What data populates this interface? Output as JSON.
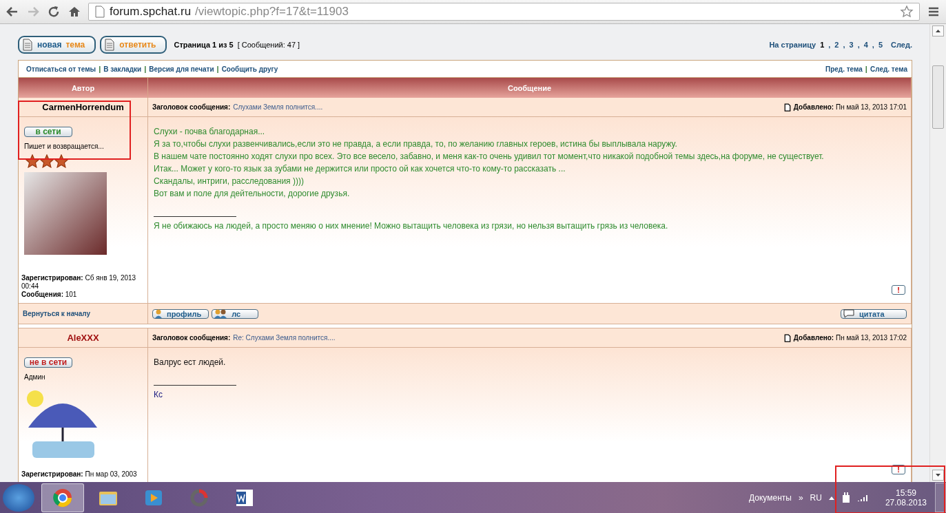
{
  "browser": {
    "url_host": "forum.spchat.ru",
    "url_path": "/viewtopic.php?f=17&t=11903"
  },
  "topic_actions": [
    {
      "label": "новая",
      "accent": "тема"
    },
    {
      "label": "ответить"
    }
  ],
  "page_info": "Страница 1 из 5",
  "post_count": "[ Сообщений: 47 ]",
  "pagination": {
    "label": "На страницу",
    "separator": ",",
    "pages": [
      {
        "label": "1",
        "selected": true
      },
      {
        "label": "2",
        "selected": false
      },
      {
        "label": "3",
        "selected": false
      },
      {
        "label": "4",
        "selected": false
      },
      {
        "label": "5",
        "selected": false
      }
    ],
    "next": "След."
  },
  "link_separator": "|",
  "topic_links": [
    "Отписаться от темы",
    "В закладки",
    "Версия для печати",
    "Сообщить другу"
  ],
  "topic_nav": [
    "Пред. тема",
    "След. тема"
  ],
  "columns": [
    "Автор",
    "Сообщение"
  ],
  "posts": [
    {
      "kind": "member",
      "author": "CarmenHorrendum",
      "status": {
        "label": "в сети",
        "online": true
      },
      "rank": "Пишет и возвращается...",
      "stars": 3,
      "registered_label": "Зарегистрирован:",
      "registered": "Сб янв 19, 2013 00:44",
      "posts_label": "Сообщения:",
      "posts": "101",
      "subject_label": "Заголовок сообщения:",
      "subject": "Слухами Земля полнится....",
      "date_label": "Добавлено:",
      "date": "Пн май 13, 2013 17:01",
      "report": "!",
      "body": [
        "Слухи - почва благодарная...",
        "Я за то,чтобы слухи развенчивались,если это не правда, а если правда, то, по желанию главных героев, истина бы выплывала наружу.",
        "В нашем чате постоянно ходят слухи про всех. Это все весело, забавно, и меня как-то очень удивил тот момент,что никакой подобной темы здесь,на форуме, не существует.",
        "Итак... Может у кого-то язык за зубами не держится или просто ой как хочется что-то кому-то рассказать ...",
        "Скандалы, интриги, расследования ))))",
        "Вот вам и поле для дейтельности, дорогие друзья."
      ],
      "signature": "Я не обижаюсь на людей, а просто меняю о них мнение! Можно вытащить человека из грязи, но нельзя вытащить грязь из человека.",
      "back_to_top": "Вернуться к началу",
      "buttons": [
        "профиль",
        "лс"
      ],
      "quote": "цитата"
    },
    {
      "kind": "admin",
      "author": "AleXXX",
      "status": {
        "label": "не в сети",
        "online": false
      },
      "rank": "Админ",
      "registered_label": "Зарегистрирован:",
      "registered": "Пн мар 03, 2003",
      "subject_label": "Заголовок сообщения:",
      "subject": "Re: Слухами Земля полнится....",
      "date_label": "Добавлено:",
      "date": "Пн май 13, 2013 17:02",
      "report": "!",
      "body": [
        "Валрус ест людей."
      ],
      "signature": "Кс"
    }
  ],
  "taskbar": {
    "apps": [
      {
        "kind": "browser",
        "selected": true
      },
      {
        "kind": "folder",
        "selected": false
      },
      {
        "kind": "player",
        "selected": false
      },
      {
        "kind": "ring",
        "selected": false
      },
      {
        "kind": "word",
        "selected": false
      }
    ],
    "toolbar": "Документы",
    "more": "»",
    "language": "RU",
    "time": "15:59",
    "date": "27.08.2013"
  }
}
